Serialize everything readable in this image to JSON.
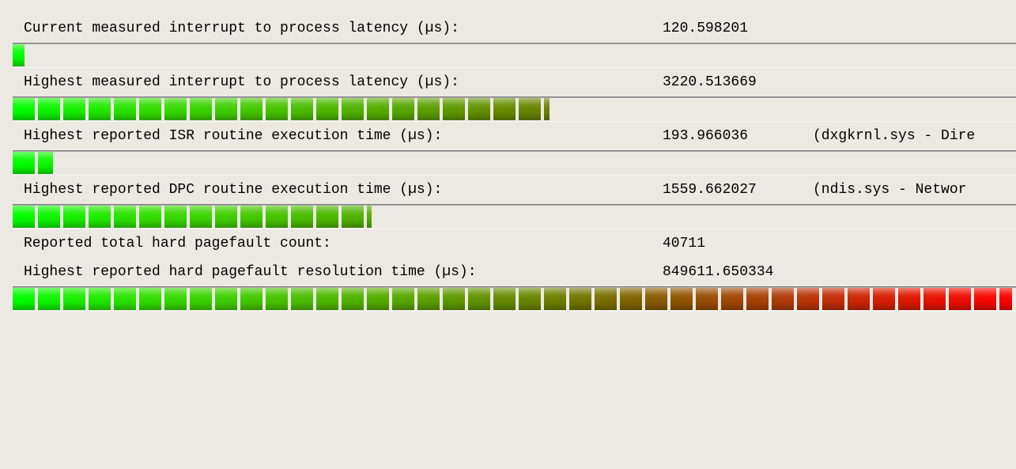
{
  "metrics": [
    {
      "label": "Current measured interrupt to process latency (µs):",
      "value": "120.598201",
      "extra": "",
      "bar_pct": 1.2
    },
    {
      "label": "Highest measured interrupt to process latency (µs):",
      "value": "3220.513669",
      "extra": "",
      "bar_pct": 53.5
    },
    {
      "label": "Highest reported ISR routine execution time (µs):",
      "value": "193.966036",
      "extra": "(dxgkrnl.sys - Dire",
      "bar_pct": 4.0
    },
    {
      "label": "Highest reported DPC routine execution time (µs):",
      "value": "1559.662027",
      "extra": "(ndis.sys - Networ",
      "bar_pct": 35.8
    }
  ],
  "pagefault": {
    "count_label": "Reported total hard pagefault count:",
    "count_value": "40711",
    "time_label": "Highest reported hard pagefault resolution time (µs):",
    "time_value": "849611.650334",
    "bar_pct": 100
  }
}
